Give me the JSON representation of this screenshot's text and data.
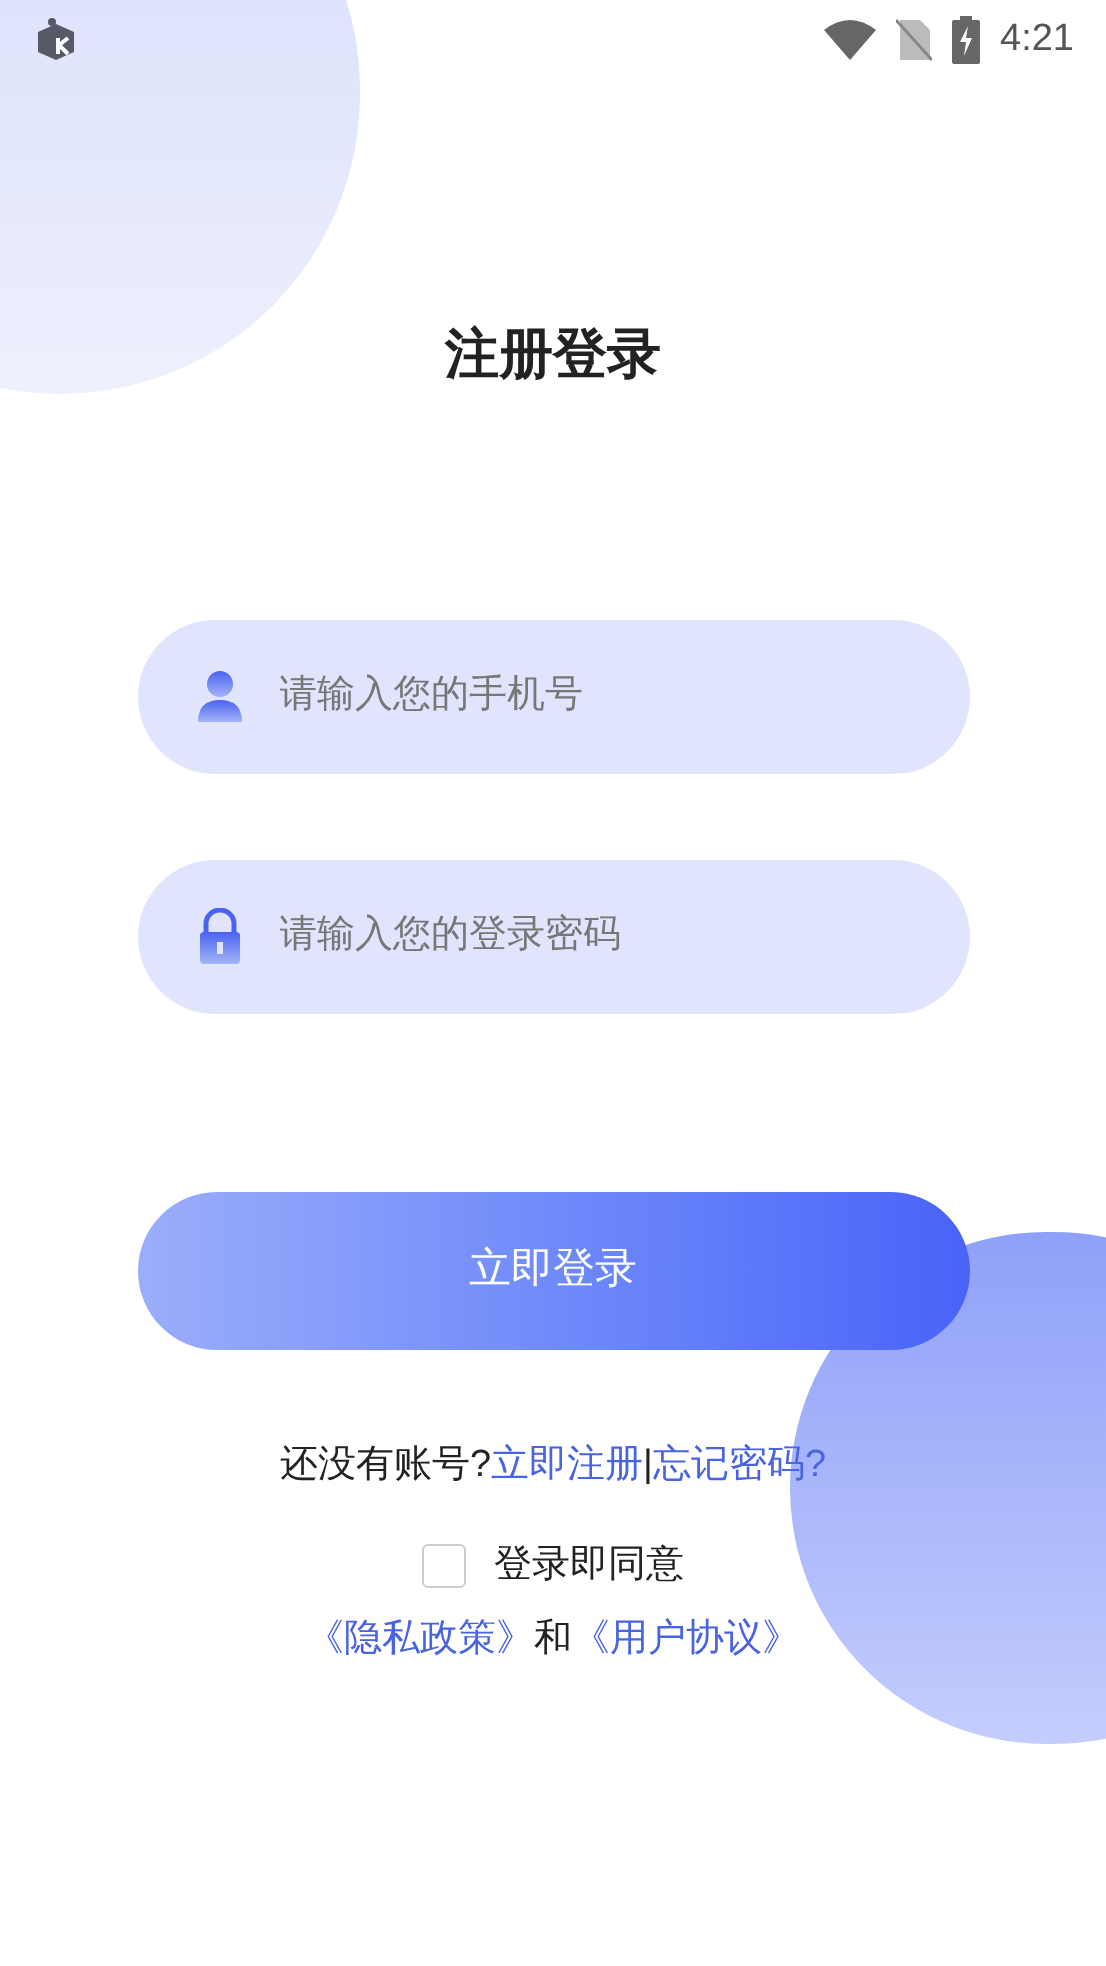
{
  "status_bar": {
    "time": "4:21"
  },
  "title": "注册登录",
  "fields": [
    {
      "kind": "phone",
      "placeholder": "请输入您的手机号"
    },
    {
      "kind": "password",
      "placeholder": "请输入您的登录密码"
    }
  ],
  "login_button": "立即登录",
  "account_links": {
    "prompt": "还没有账号?",
    "register": "立即注册",
    "separator": "|",
    "forgot": "忘记密码?"
  },
  "agreement": {
    "checked": false,
    "label": "登录即同意",
    "privacy": "《隐私政策》",
    "and": "和",
    "terms": "《用户协议》"
  }
}
